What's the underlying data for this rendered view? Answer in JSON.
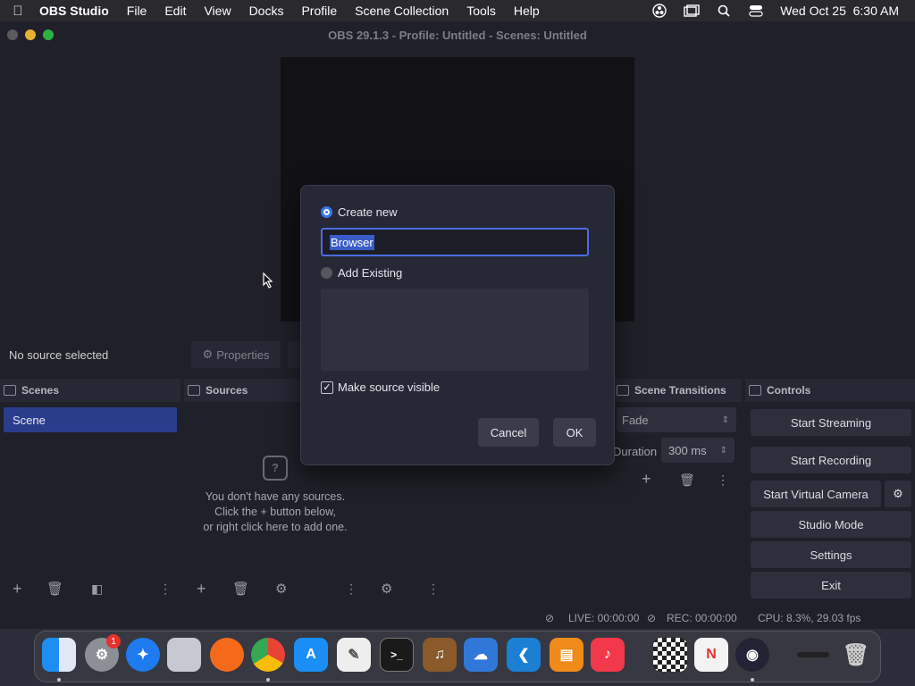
{
  "menubar": {
    "app_name": "OBS Studio",
    "items": [
      "File",
      "Edit",
      "View",
      "Docks",
      "Profile",
      "Scene Collection",
      "Tools",
      "Help"
    ],
    "clock": "Wed Oct 25  6:30 AM"
  },
  "window": {
    "title": "OBS 29.1.3 - Profile: Untitled - Scenes: Untitled"
  },
  "source_bar": {
    "no_source": "No source selected",
    "properties": "Properties"
  },
  "docks": {
    "scenes": {
      "title": "Scenes",
      "items": [
        "Scene"
      ]
    },
    "sources": {
      "title": "Sources",
      "empty_lines": [
        "You don't have any sources.",
        "Click the + button below,",
        "or right click here to add one."
      ]
    },
    "transitions": {
      "title": "Scene Transitions",
      "type": "Fade",
      "duration_label": "Duration",
      "duration_value": "300 ms"
    },
    "controls": {
      "title": "Controls",
      "buttons": [
        "Start Streaming",
        "Start Recording",
        "Start Virtual Camera",
        "Studio Mode",
        "Settings",
        "Exit"
      ]
    }
  },
  "status": {
    "live": "LIVE: 00:00:00",
    "rec": "REC: 00:00:00",
    "cpu": "CPU: 8.3%, 29.03 fps"
  },
  "dialog": {
    "create_new": "Create new",
    "name_value": "Browser",
    "add_existing": "Add Existing",
    "make_visible": "Make source visible",
    "cancel": "Cancel",
    "ok": "OK"
  },
  "dock_apps": {
    "settings_badge": "1"
  },
  "colors": {
    "accent": "#3a78f0",
    "scene_selected": "#2a3d8c"
  }
}
